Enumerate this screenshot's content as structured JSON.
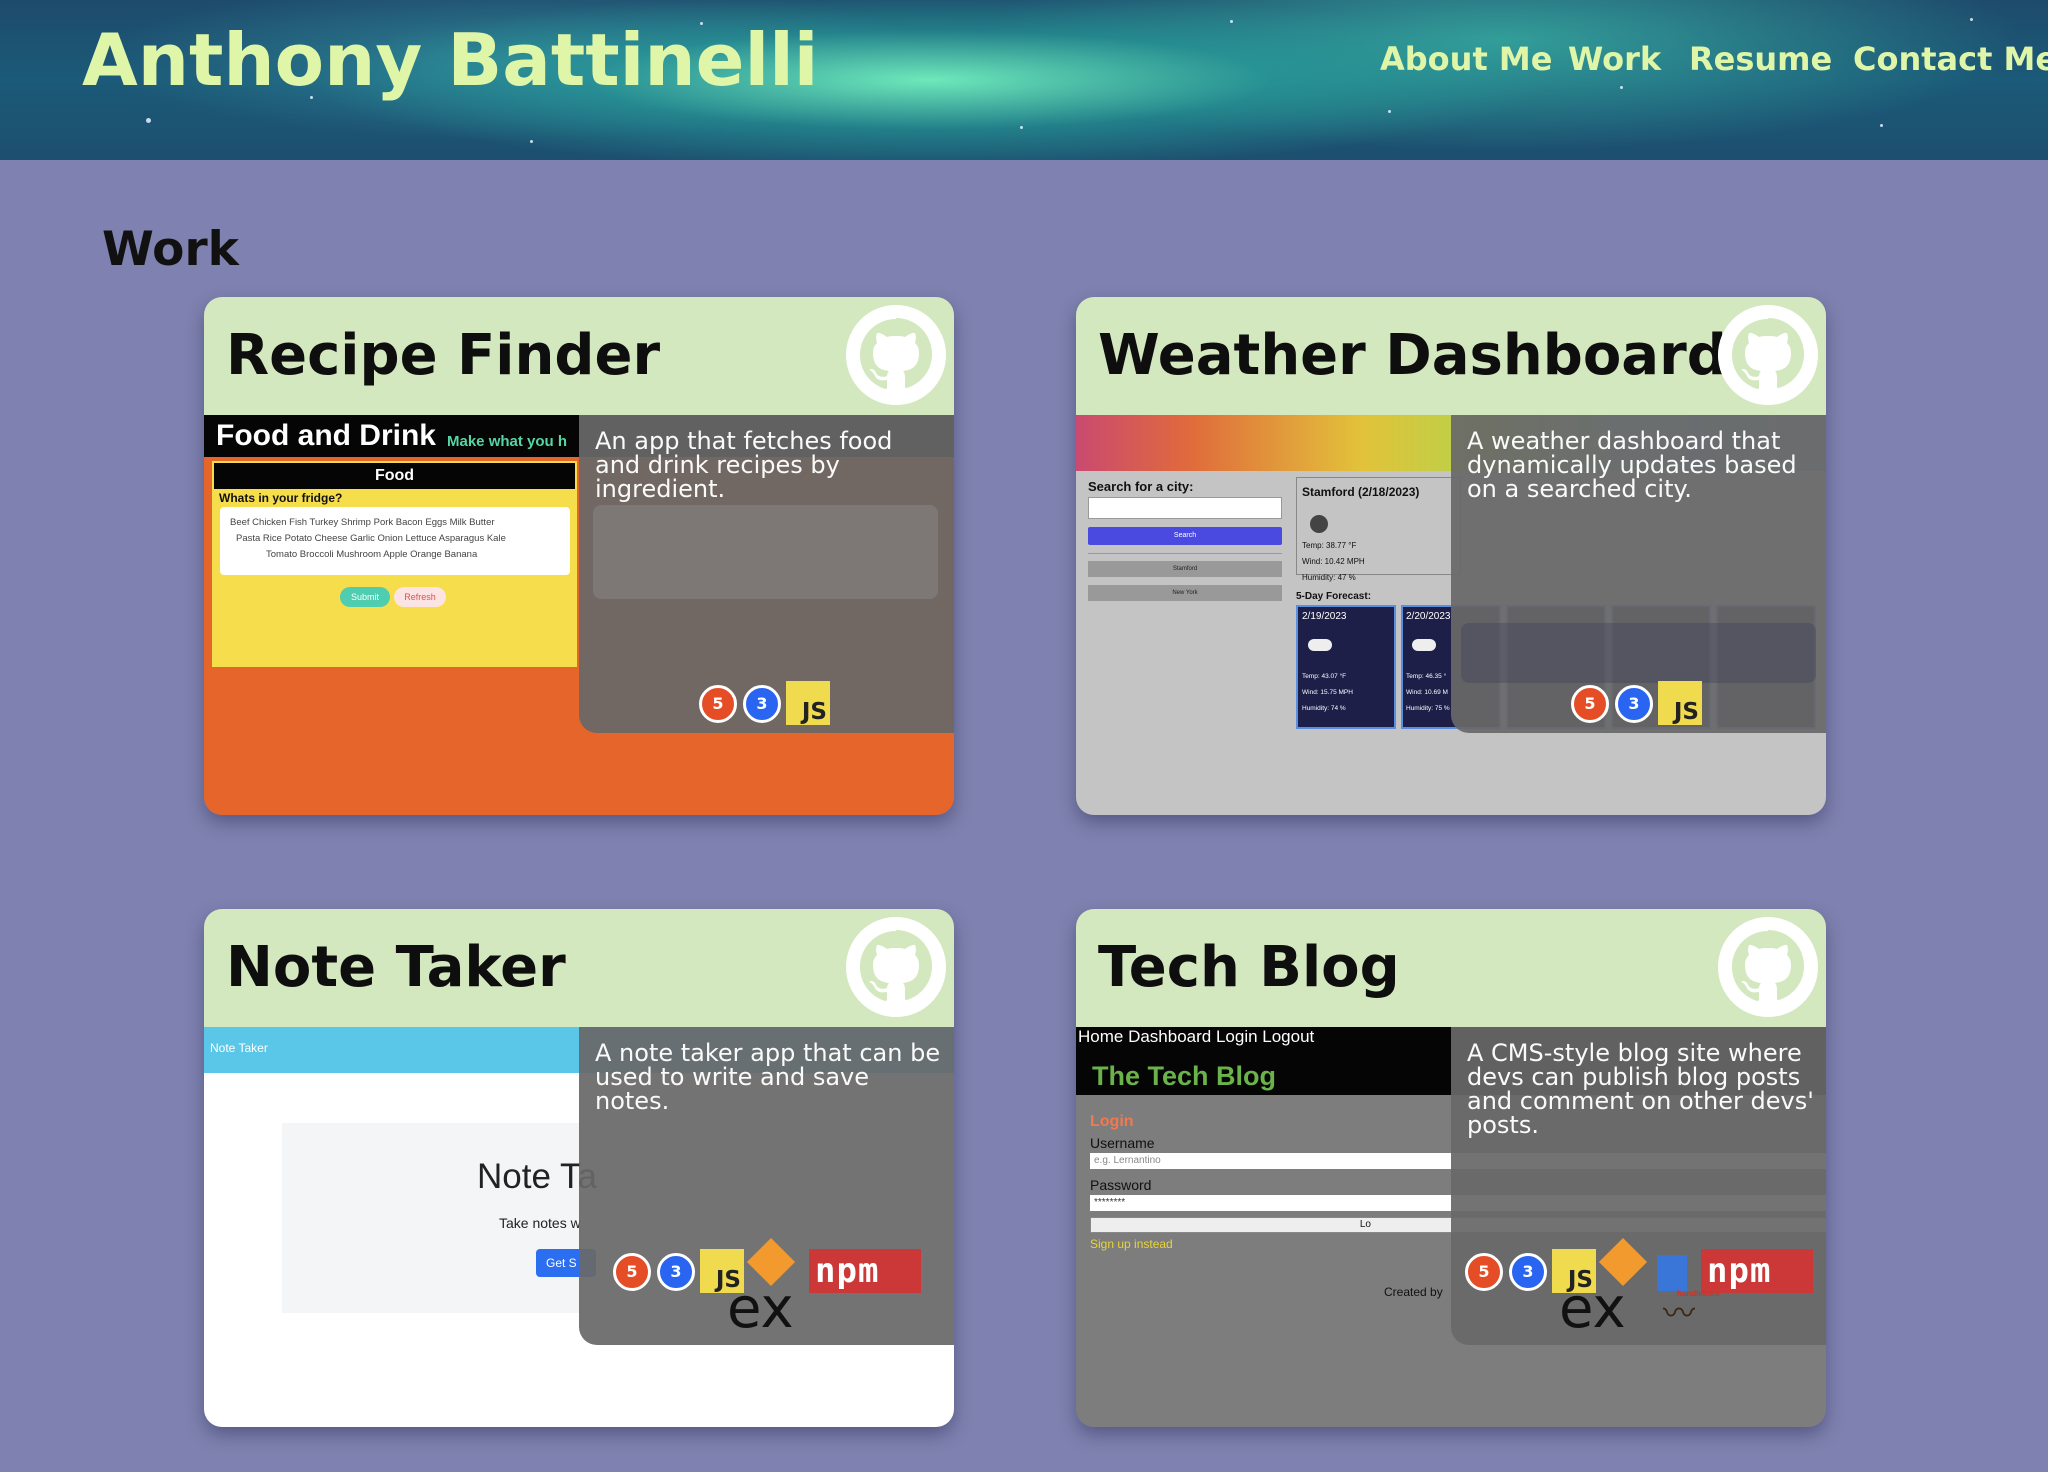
{
  "site": {
    "title": "Anthony Battinelli"
  },
  "nav": [
    {
      "label": "About Me"
    },
    {
      "label": "Work"
    },
    {
      "label": "Resume"
    },
    {
      "label": "Contact Me"
    }
  ],
  "work": {
    "heading": "Work",
    "projects": [
      {
        "title": "Recipe Finder",
        "description": "An app that fetches food and drink recipes by ingredient.",
        "tech": [
          "html5-icon",
          "css3-icon",
          "javascript-icon"
        ],
        "preview": {
          "brand": "Food and Drink",
          "tagline": "Make what you h",
          "panel_title": "Food",
          "question": "Whats in your fridge?",
          "ingredients_row1": "Beef  Chicken  Fish  Turkey  Shrimp  Pork  Bacon  Eggs  Milk  Butter",
          "ingredients_row2": "Pasta  Rice  Potato  Cheese  Garlic  Onion  Lettuce  Asparagus  Kale",
          "ingredients_row3": "Tomato  Broccoli  Mushroom  Apple  Orange  Banana",
          "submit": "Submit",
          "refresh": "Refresh"
        }
      },
      {
        "title": "Weather Dashboard",
        "description": "A weather dashboard that dynamically updates based on a searched city.",
        "tech": [
          "html5-icon",
          "css3-icon",
          "javascript-icon"
        ],
        "preview": {
          "search_label": "Search for a city:",
          "search_button": "Search",
          "history_1": "Stamford",
          "history_2": "New York",
          "current_city": "Stamford  (2/18/2023)",
          "temp": "Temp: 38.77 °F",
          "wind": "Wind: 10.42 MPH",
          "humidity": "Humidity: 47 %",
          "forecast_label": "5-Day Forecast:",
          "day1_date": "2/19/2023",
          "day1_temp": "Temp: 43.07 °F",
          "day1_wind": "Wind: 15.75 MPH",
          "day1_humidity": "Humidity: 74 %",
          "day2_date": "2/20/2023",
          "day2_temp": "Temp: 46.35 °",
          "day2_wind": "Wind: 10.69 M",
          "day2_humidity": "Humidity: 75 %"
        }
      },
      {
        "title": "Note Taker",
        "description": "A note taker app that can be used to write and save notes.",
        "tech": [
          "html5-icon",
          "css3-icon",
          "javascript-icon",
          "nodejs-icon",
          "npm-icon",
          "express-icon"
        ],
        "preview": {
          "navbar": "Note Taker",
          "hero_title": "Note Ta",
          "hero_sub": "Take notes w",
          "cta": "Get S"
        }
      },
      {
        "title": "Tech Blog",
        "description": "A CMS-style blog site where devs can publish blog posts and comment on other devs' posts.",
        "tech": [
          "html5-icon",
          "css3-icon",
          "javascript-icon",
          "nodejs-icon",
          "sequelize-icon",
          "npm-icon",
          "express-icon",
          "handlebars-icon"
        ],
        "preview": {
          "nav": "Home  Dashboard  Login  Logout",
          "brand": "The Tech Blog",
          "login_heading": "Login",
          "username_label": "Username",
          "username_placeholder": "e.g. Lernantino",
          "password_label": "Password",
          "password_value": "********",
          "login_button": "Lo",
          "signup_link": "Sign up instead",
          "footer": "Created by"
        }
      }
    ]
  },
  "icons": {
    "html5": "5",
    "css3": "3",
    "js": "JS",
    "npm": "npm",
    "express": "ex",
    "sql": "SQL",
    "handlebars": "handlebars"
  },
  "colors": {
    "background": "#7f82b0",
    "header_text": "#dff5a7",
    "card_header": "#d3e8bf",
    "overlay": "#686868"
  }
}
